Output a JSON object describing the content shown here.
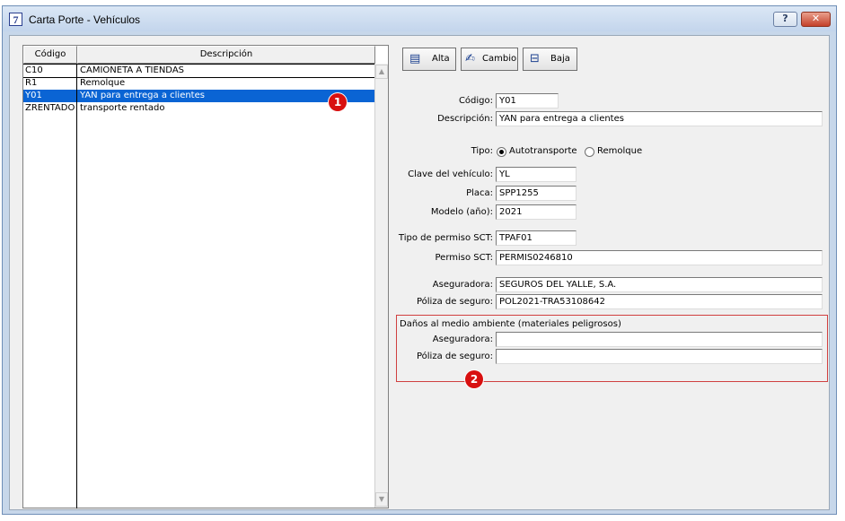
{
  "window": {
    "title": "Carta Porte - Vehículos",
    "app_icon": "7",
    "help_label": "?",
    "close_label": "✕"
  },
  "list": {
    "columns": [
      "Código",
      "Descripción"
    ],
    "rows": [
      {
        "codigo": "C10",
        "descripcion": "CAMIONETA A TIENDAS"
      },
      {
        "codigo": "R1",
        "descripcion": "Remolque"
      },
      {
        "codigo": "Y01",
        "descripcion": "YAN para entrega a clientes"
      },
      {
        "codigo": "ZRENTADO",
        "descripcion": "transporte rentado"
      }
    ],
    "selected_index": 2,
    "scroll_up": "▲",
    "scroll_down": "▼"
  },
  "toolbar": {
    "alta": {
      "label": "Alta",
      "icon": "list-icon",
      "glyph": "▤"
    },
    "cambio": {
      "label": "Cambio",
      "icon": "edit-icon",
      "glyph": "✍"
    },
    "baja": {
      "label": "Baja",
      "icon": "delete-icon",
      "glyph": "⊟"
    }
  },
  "form": {
    "codigo": {
      "label": "Código:",
      "value": "Y01"
    },
    "descripcion": {
      "label": "Descripción:",
      "value": "YAN para entrega a clientes"
    },
    "tipo": {
      "label": "Tipo:",
      "options": [
        "Autotransporte",
        "Remolque"
      ],
      "selected": "Autotransporte"
    },
    "clave_vehiculo": {
      "label": "Clave del vehículo:",
      "value": "YL"
    },
    "placa": {
      "label": "Placa:",
      "value": "SPP1255"
    },
    "modelo": {
      "label": "Modelo (año):",
      "value": "2021"
    },
    "tipo_permiso": {
      "label": "Tipo de permiso SCT:",
      "value": "TPAF01"
    },
    "permiso": {
      "label": "Permiso SCT:",
      "value": "PERMIS0246810"
    },
    "aseguradora": {
      "label": "Aseguradora:",
      "value": "SEGUROS DEL YALLE, S.A."
    },
    "poliza": {
      "label": "Póliza de seguro:",
      "value": "POL2021-TRA53108642"
    },
    "danos": {
      "title": "Daños al medio ambiente (materiales peligrosos)",
      "aseguradora": {
        "label": "Aseguradora:",
        "value": ""
      },
      "poliza": {
        "label": "Póliza de seguro:",
        "value": ""
      }
    }
  },
  "annotations": [
    "1",
    "2"
  ],
  "colors": {
    "selection": "#0a64d4",
    "badge": "#d81010",
    "group_border": "#d04040"
  }
}
